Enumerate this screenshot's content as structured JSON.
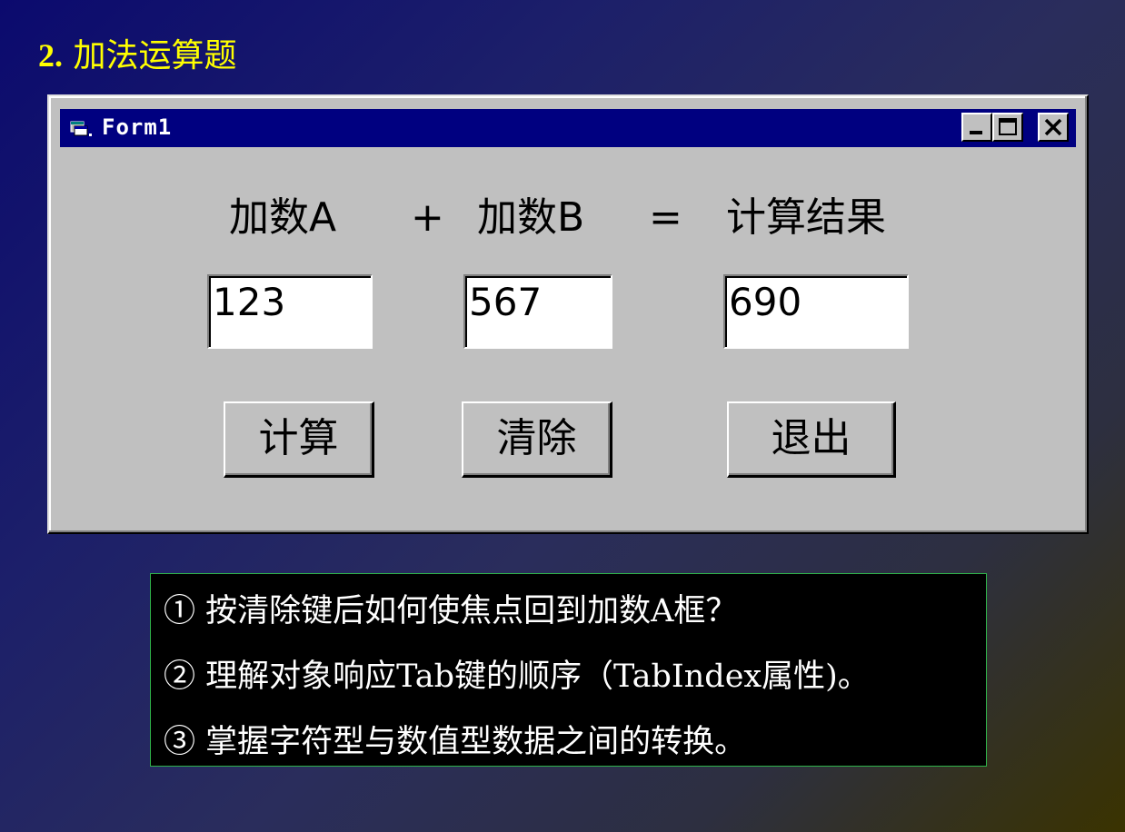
{
  "slide": {
    "number": "2.",
    "title": "加法运算题"
  },
  "window": {
    "title": "Form1",
    "icon": "vb-form-icon",
    "controls": {
      "minimize": "minimize-icon",
      "maximize": "maximize-icon",
      "close": "close-icon"
    }
  },
  "form": {
    "labels": {
      "addend_a": "加数A",
      "plus": "+",
      "addend_b": "加数B",
      "equals": "=",
      "result": "计算结果"
    },
    "fields": {
      "addend_a_value": "123",
      "addend_b_value": "567",
      "result_value": "690"
    },
    "buttons": {
      "calculate": "计算",
      "clear": "清除",
      "exit": "退出"
    }
  },
  "notes": [
    "① 按清除键后如何使焦点回到加数A框？",
    "② 理解对象响应Tab键的顺序（TabIndex属性)。",
    "③ 掌握字符型与数值型数据之间的转换。"
  ],
  "colors": {
    "title_yellow": "#ffff00",
    "titlebar_blue": "#000080",
    "window_gray": "#c0c0c0",
    "notes_border": "#2fb34a"
  }
}
